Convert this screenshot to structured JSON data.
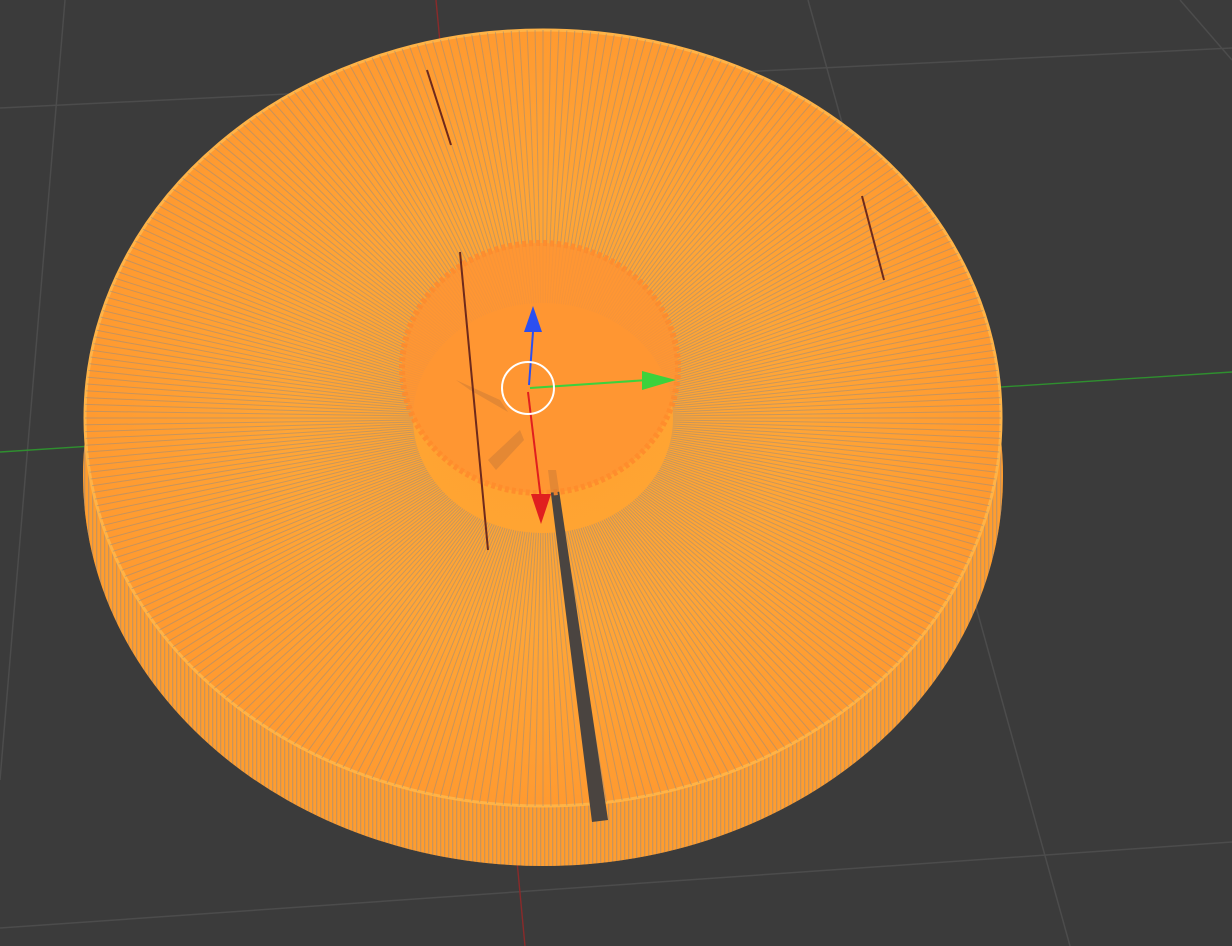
{
  "viewport": {
    "background": "#3b3b3b",
    "grid_color": "#4a4a4a",
    "axis_x_color": "#2f8f2f",
    "axis_y_color": "#8a2a2a"
  },
  "mesh": {
    "object": "cylinder",
    "selected": true,
    "selection_color": "#ffa033",
    "wire_color": "#9a8a7a",
    "shade_color": "#ff8f2a"
  },
  "gizmo": {
    "type": "translate",
    "x_color": "#e01f1f",
    "y_color": "#3cd23c",
    "z_color": "#2b4ff0",
    "ring_color": "#ffffff",
    "icon_x": "arrow-x-icon",
    "icon_y": "arrow-y-icon",
    "icon_z": "arrow-z-icon",
    "icon_center": "transform-center-icon"
  }
}
